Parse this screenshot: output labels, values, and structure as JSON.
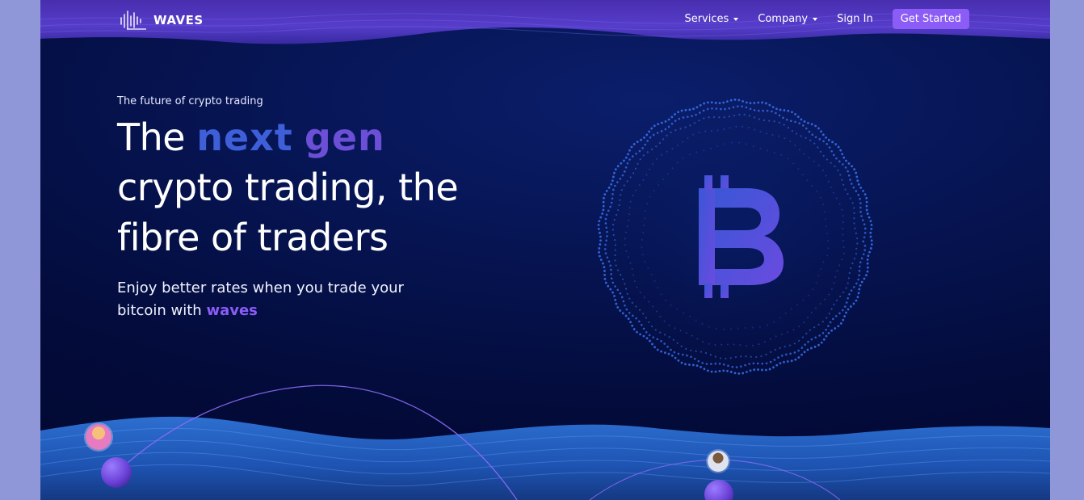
{
  "nav": {
    "brand": "WAVES",
    "items": [
      {
        "label": "Services",
        "has_dropdown": true
      },
      {
        "label": "Company",
        "has_dropdown": true
      },
      {
        "label": "Sign In",
        "has_dropdown": false
      }
    ],
    "cta_label": "Get Started"
  },
  "hero": {
    "eyebrow": "The future of crypto trading",
    "headline_prefix": "The",
    "headline_highlight_1": "next",
    "headline_highlight_2": "gen",
    "headline_line2": "crypto trading, the",
    "headline_line3": "fibre of traders",
    "subhead_line1": "Enjoy better rates when you trade your",
    "subhead_line2_prefix": "bitcoin with",
    "subhead_brand": "waves"
  },
  "colors": {
    "accent": "#8b5cf6",
    "blue_highlight": "#3e5fd8",
    "purple_highlight": "#6b4fd6",
    "background_dark": "#030b3a"
  },
  "icons": {
    "brand_mark": "sound-wave-icon",
    "globe_symbol": "bitcoin-icon",
    "dropdown": "caret-down-icon"
  }
}
